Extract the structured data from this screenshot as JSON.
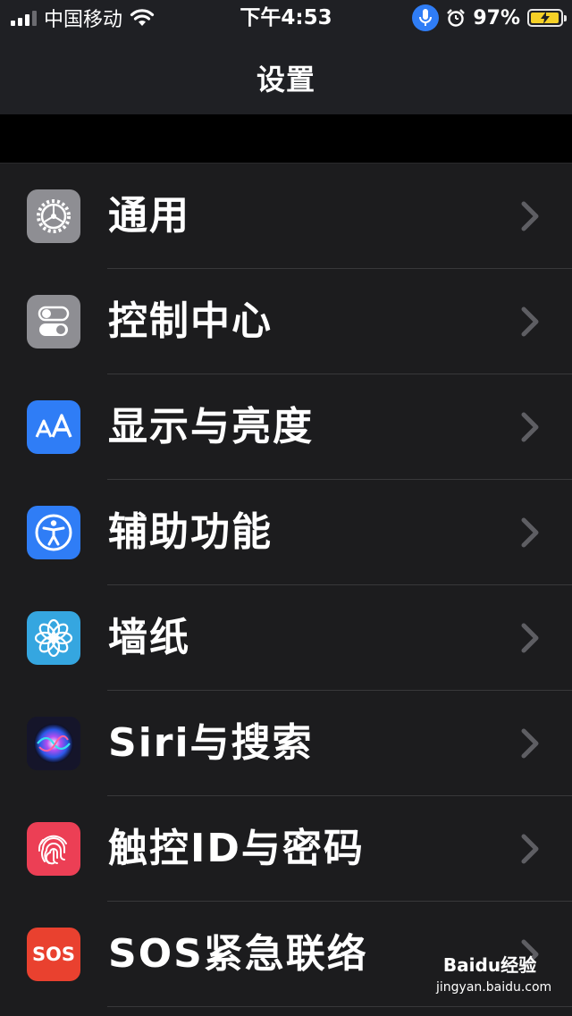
{
  "status_bar": {
    "carrier": "中国移动",
    "time": "下午4:53",
    "battery_percent": "97%",
    "battery_level": 0.97,
    "signal_bars": 3,
    "icons": [
      "signal-icon",
      "wifi-icon",
      "microphone-icon",
      "alarm-icon",
      "battery-charging-icon"
    ],
    "mic_color": "#2f7df6",
    "battery_color": "#f5d027"
  },
  "nav": {
    "title": "设置"
  },
  "settings": [
    {
      "label": "通用",
      "icon": "gear-icon",
      "icon_bg": "#8e8e93"
    },
    {
      "label": "控制中心",
      "icon": "toggles-icon",
      "icon_bg": "#8e8e93"
    },
    {
      "label": "显示与亮度",
      "icon": "text-size-icon",
      "icon_bg": "#2f7df6"
    },
    {
      "label": "辅助功能",
      "icon": "accessibility-icon",
      "icon_bg": "#2f7df6"
    },
    {
      "label": "墙纸",
      "icon": "flower-icon",
      "icon_bg": "#35a6e0"
    },
    {
      "label": "Siri与搜索",
      "icon": "siri-icon",
      "icon_bg": "#1a1a2e"
    },
    {
      "label": "触控ID与密码",
      "icon": "fingerprint-icon",
      "icon_bg": "#ec3f55"
    },
    {
      "label": "SOS紧急联络",
      "icon": "sos-icon",
      "icon_bg": "#e9412f"
    }
  ],
  "sos_icon_text": "SOS",
  "watermark": {
    "brand": "Baidu经验",
    "url": "jingyan.baidu.com"
  }
}
